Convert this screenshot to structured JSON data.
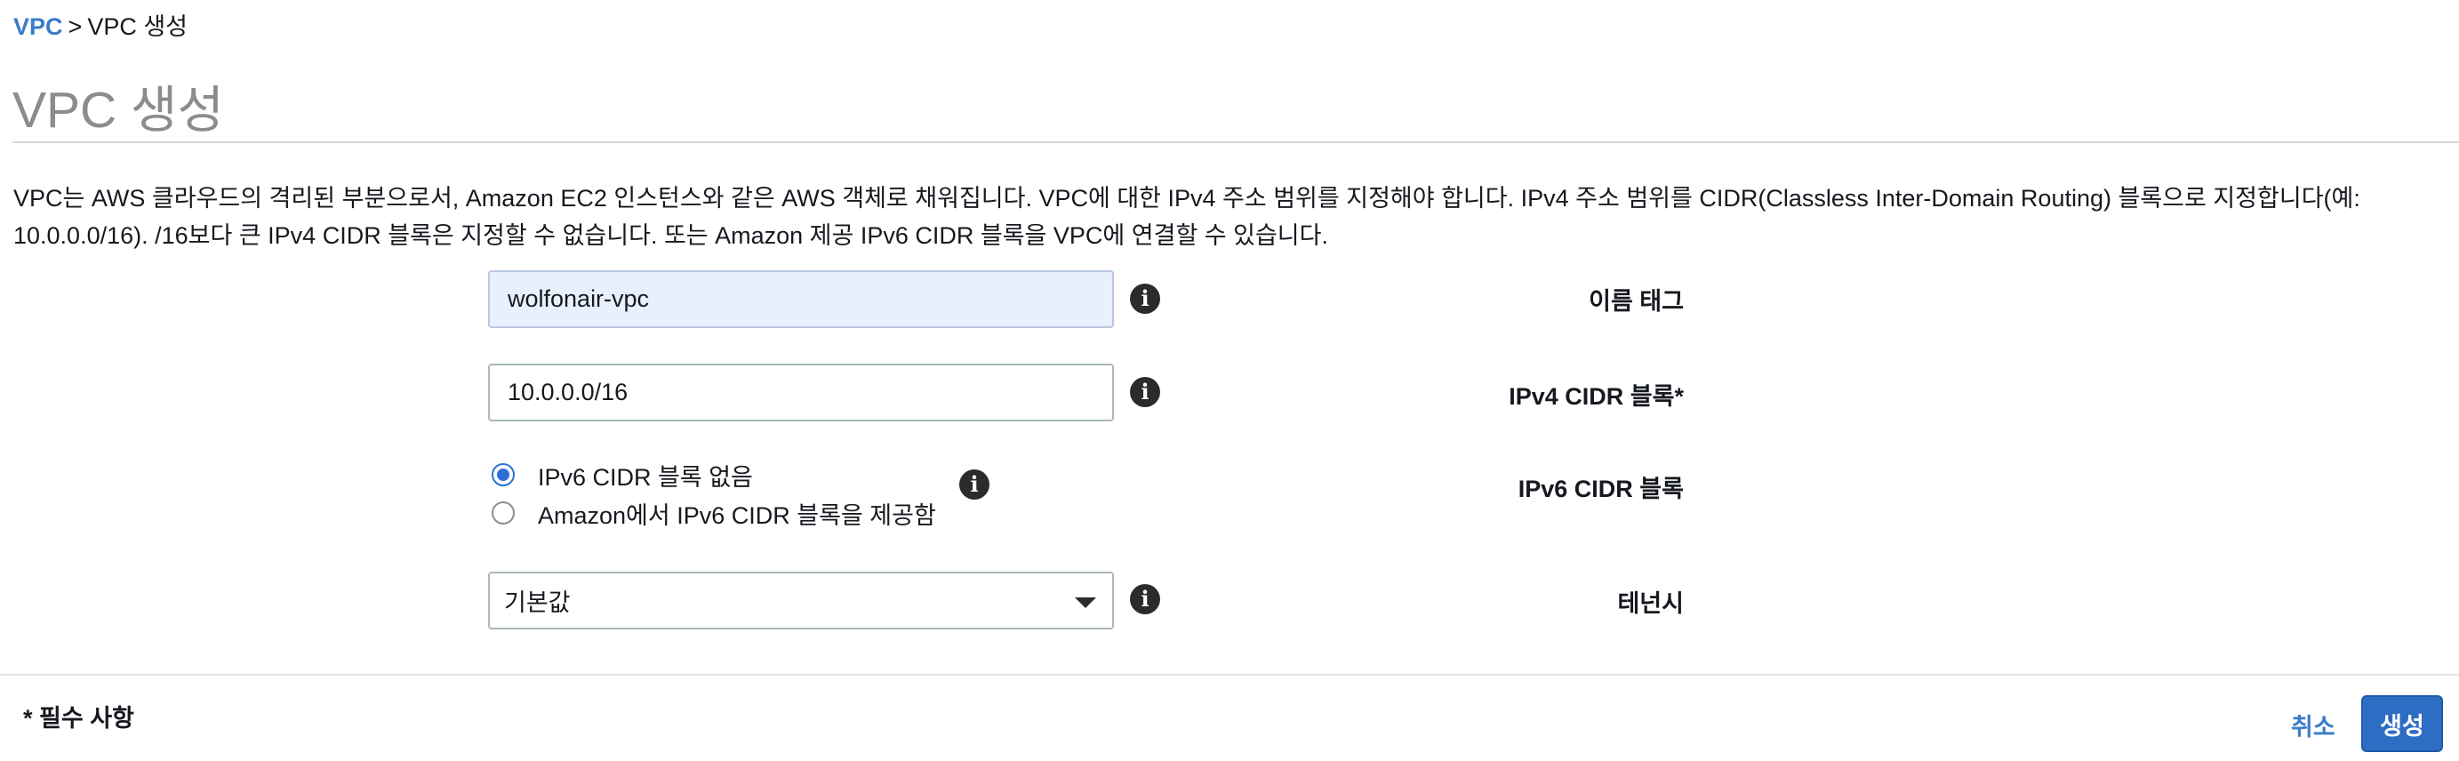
{
  "breadcrumb": {
    "root": "VPC",
    "separator": ">",
    "current": "VPC 생성"
  },
  "page_title": "VPC 생성",
  "description": "VPC는 AWS 클라우드의 격리된 부분으로서, Amazon EC2 인스턴스와 같은 AWS 객체로 채워집니다. VPC에 대한 IPv4 주소 범위를 지정해야 합니다. IPv4 주소 범위를 CIDR(Classless Inter-Domain Routing) 블록으로 지정합니다(예: 10.0.0.0/16). /16보다 큰 IPv4 CIDR 블록은 지정할 수 없습니다. 또는 Amazon 제공 IPv6 CIDR 블록을 VPC에 연결할 수 있습니다.",
  "form": {
    "name_tag": {
      "label": "이름 태그",
      "value": "wolfonair-vpc"
    },
    "ipv4_cidr": {
      "label": "IPv4 CIDR 블록*",
      "value": "10.0.0.0/16"
    },
    "ipv6_cidr": {
      "label": "IPv6 CIDR 블록",
      "options": [
        {
          "label": "IPv6 CIDR 블록 없음",
          "selected": true
        },
        {
          "label": "Amazon에서 IPv6 CIDR 블록을 제공함",
          "selected": false
        }
      ]
    },
    "tenancy": {
      "label": "테넌시",
      "value": "기본값"
    }
  },
  "footer": {
    "required_note": "* 필수 사항",
    "cancel_label": "취소",
    "create_label": "생성"
  },
  "colors": {
    "link": "#3a7cc8",
    "primary_button": "#2e6dc4",
    "autofill_background": "#e8f0fe",
    "radio_selected": "#2d6fd6"
  },
  "icons": {
    "info": "info-icon",
    "dropdown": "caret-down-icon"
  }
}
